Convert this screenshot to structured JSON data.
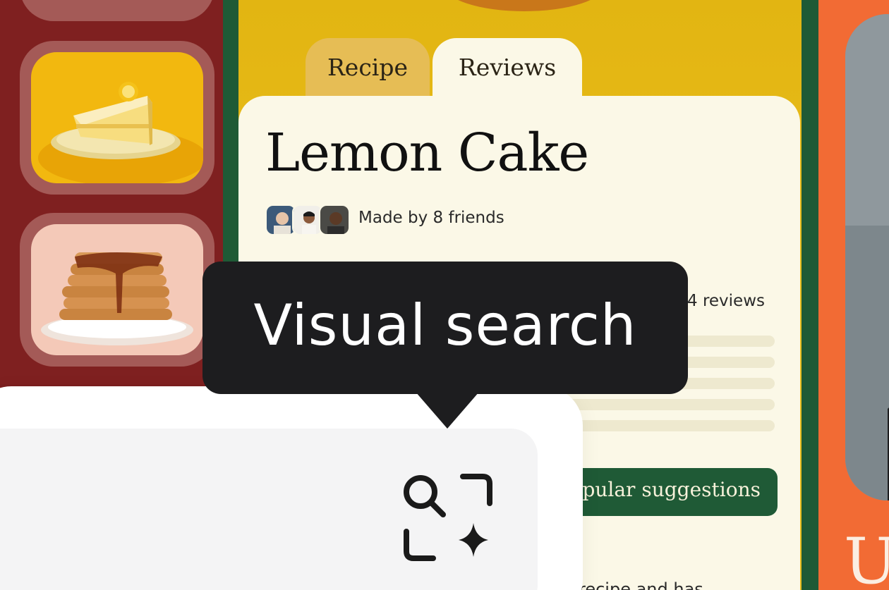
{
  "tabs": {
    "recipe_label": "Recipe",
    "reviews_label": "Reviews",
    "active": "Reviews"
  },
  "recipe": {
    "title": "Lemon Cake",
    "made_by": "Made by 8 friends",
    "reviews_count": "4 reviews",
    "suggestions_button": "pular suggestions",
    "body_text_fragment": "recipe and has"
  },
  "thumbnails": [
    {
      "name": "lemon-cake-thumbnail",
      "icon": "lemon-cake-slice"
    },
    {
      "name": "pancakes-thumbnail",
      "icon": "pancake-stack"
    }
  ],
  "tooltip": {
    "text": "Visual search"
  },
  "search_button": {
    "icon": "visual-search-icon"
  },
  "right_panel": {
    "letter": "U"
  },
  "colors": {
    "left_background": "#7f2020",
    "thumb_frame": "#a45a57",
    "phone_frame": "#1f5a36",
    "screen_yellow": "#e2b512",
    "card_cream": "#fbf8e7",
    "tab_inactive": "#e6bd55",
    "suggest_green": "#1f5a36",
    "orange_panel": "#f26b34",
    "tooltip_bg": "#1d1d1f",
    "panel_white": "#ffffff",
    "panel_inner": "#f4f4f5"
  }
}
